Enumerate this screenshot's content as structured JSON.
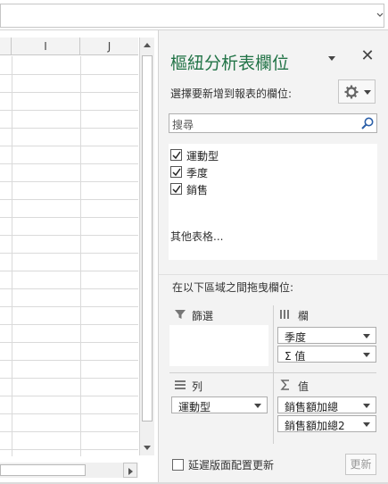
{
  "sheet": {
    "columns": [
      "I",
      "J"
    ]
  },
  "pivot_pane": {
    "title": "樞紐分析表欄位",
    "choose_fields_label": "選擇要新增到報表的欄位:",
    "search_placeholder": "搜尋",
    "fields": [
      {
        "label": "運動型",
        "checked": true
      },
      {
        "label": "季度",
        "checked": true
      },
      {
        "label": "銷售",
        "checked": true
      }
    ],
    "more_tables": "其他表格...",
    "drag_label": "在以下區域之間拖曳欄位:",
    "areas": {
      "filters": {
        "title": "篩選",
        "items": []
      },
      "columns": {
        "title": "欄",
        "items": [
          "季度",
          "Σ 值"
        ]
      },
      "rows": {
        "title": "列",
        "items": [
          "運動型"
        ]
      },
      "values": {
        "title": "值",
        "items": [
          "銷售額加總",
          "銷售額加總2"
        ]
      }
    },
    "defer_update_label": "延遲版面配置更新",
    "update_button": "更新",
    "accent_color": "#217346"
  },
  "icons": {
    "search": "search-icon",
    "gear": "gear-icon",
    "close": "close-icon",
    "filter": "filter-icon",
    "columns": "columns-icon",
    "rows": "rows-icon",
    "sigma": "sigma-icon"
  }
}
